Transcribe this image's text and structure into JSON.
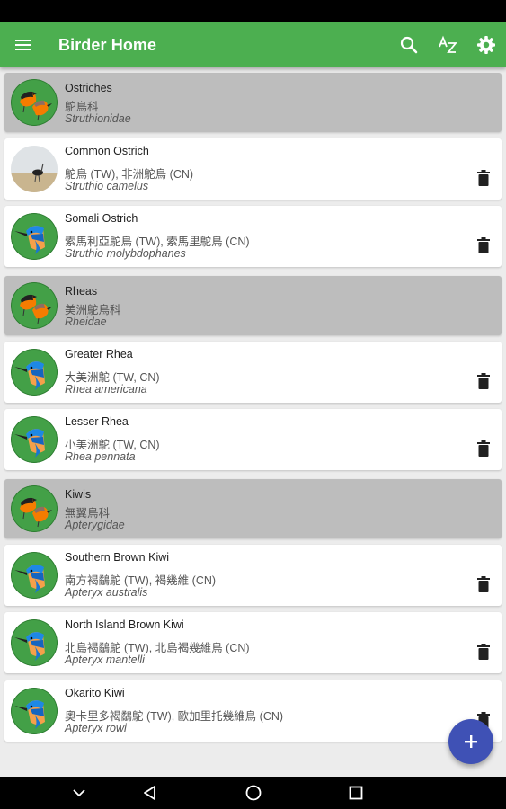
{
  "app": {
    "title": "Birder Home"
  },
  "toolbar": {
    "icons": [
      "menu-icon",
      "search-icon",
      "sort-az-icon",
      "settings-gear-icon"
    ]
  },
  "colors": {
    "appbar": "#4caf50",
    "family_card": "#bdbdbd",
    "species_card": "#ffffff",
    "fab": "#3f51b5",
    "avatar_green": "#43a047"
  },
  "list": [
    {
      "type": "family",
      "name": "Ostriches",
      "chinese": "鴕鳥科",
      "scientific": "Struthionidae"
    },
    {
      "type": "species",
      "name": "Common Ostrich",
      "chinese": "鴕鳥 (TW), 非洲鴕鳥 (CN)",
      "scientific": "Struthio camelus",
      "photo": true
    },
    {
      "type": "species",
      "name": "Somali Ostrich",
      "chinese": "索馬利亞鴕鳥 (TW), 索馬里鴕鳥 (CN)",
      "scientific": "Struthio molybdophanes"
    },
    {
      "type": "family",
      "name": "Rheas",
      "chinese": "美洲鴕鳥科",
      "scientific": "Rheidae"
    },
    {
      "type": "species",
      "name": "Greater Rhea",
      "chinese": "大美洲鴕 (TW, CN)",
      "scientific": "Rhea americana"
    },
    {
      "type": "species",
      "name": "Lesser Rhea",
      "chinese": "小美洲鴕 (TW, CN)",
      "scientific": "Rhea pennata"
    },
    {
      "type": "family",
      "name": "Kiwis",
      "chinese": "無翼鳥科",
      "scientific": "Apterygidae"
    },
    {
      "type": "species",
      "name": "Southern Brown Kiwi",
      "chinese": "南方褐鷸鴕 (TW), 褐幾維 (CN)",
      "scientific": "Apteryx australis"
    },
    {
      "type": "species",
      "name": "North Island Brown Kiwi",
      "chinese": "北島褐鷸鴕 (TW), 北島褐幾維鳥 (CN)",
      "scientific": "Apteryx mantelli"
    },
    {
      "type": "species",
      "name": "Okarito Kiwi",
      "chinese": "奧卡里多褐鷸鴕 (TW), 歐加里托幾維鳥 (CN)",
      "scientific": "Apteryx rowi"
    }
  ],
  "fab": {
    "icon": "plus-icon"
  },
  "navbar": {
    "icons": [
      "hide-keyboard-icon",
      "back-icon",
      "home-icon",
      "recents-icon"
    ]
  }
}
